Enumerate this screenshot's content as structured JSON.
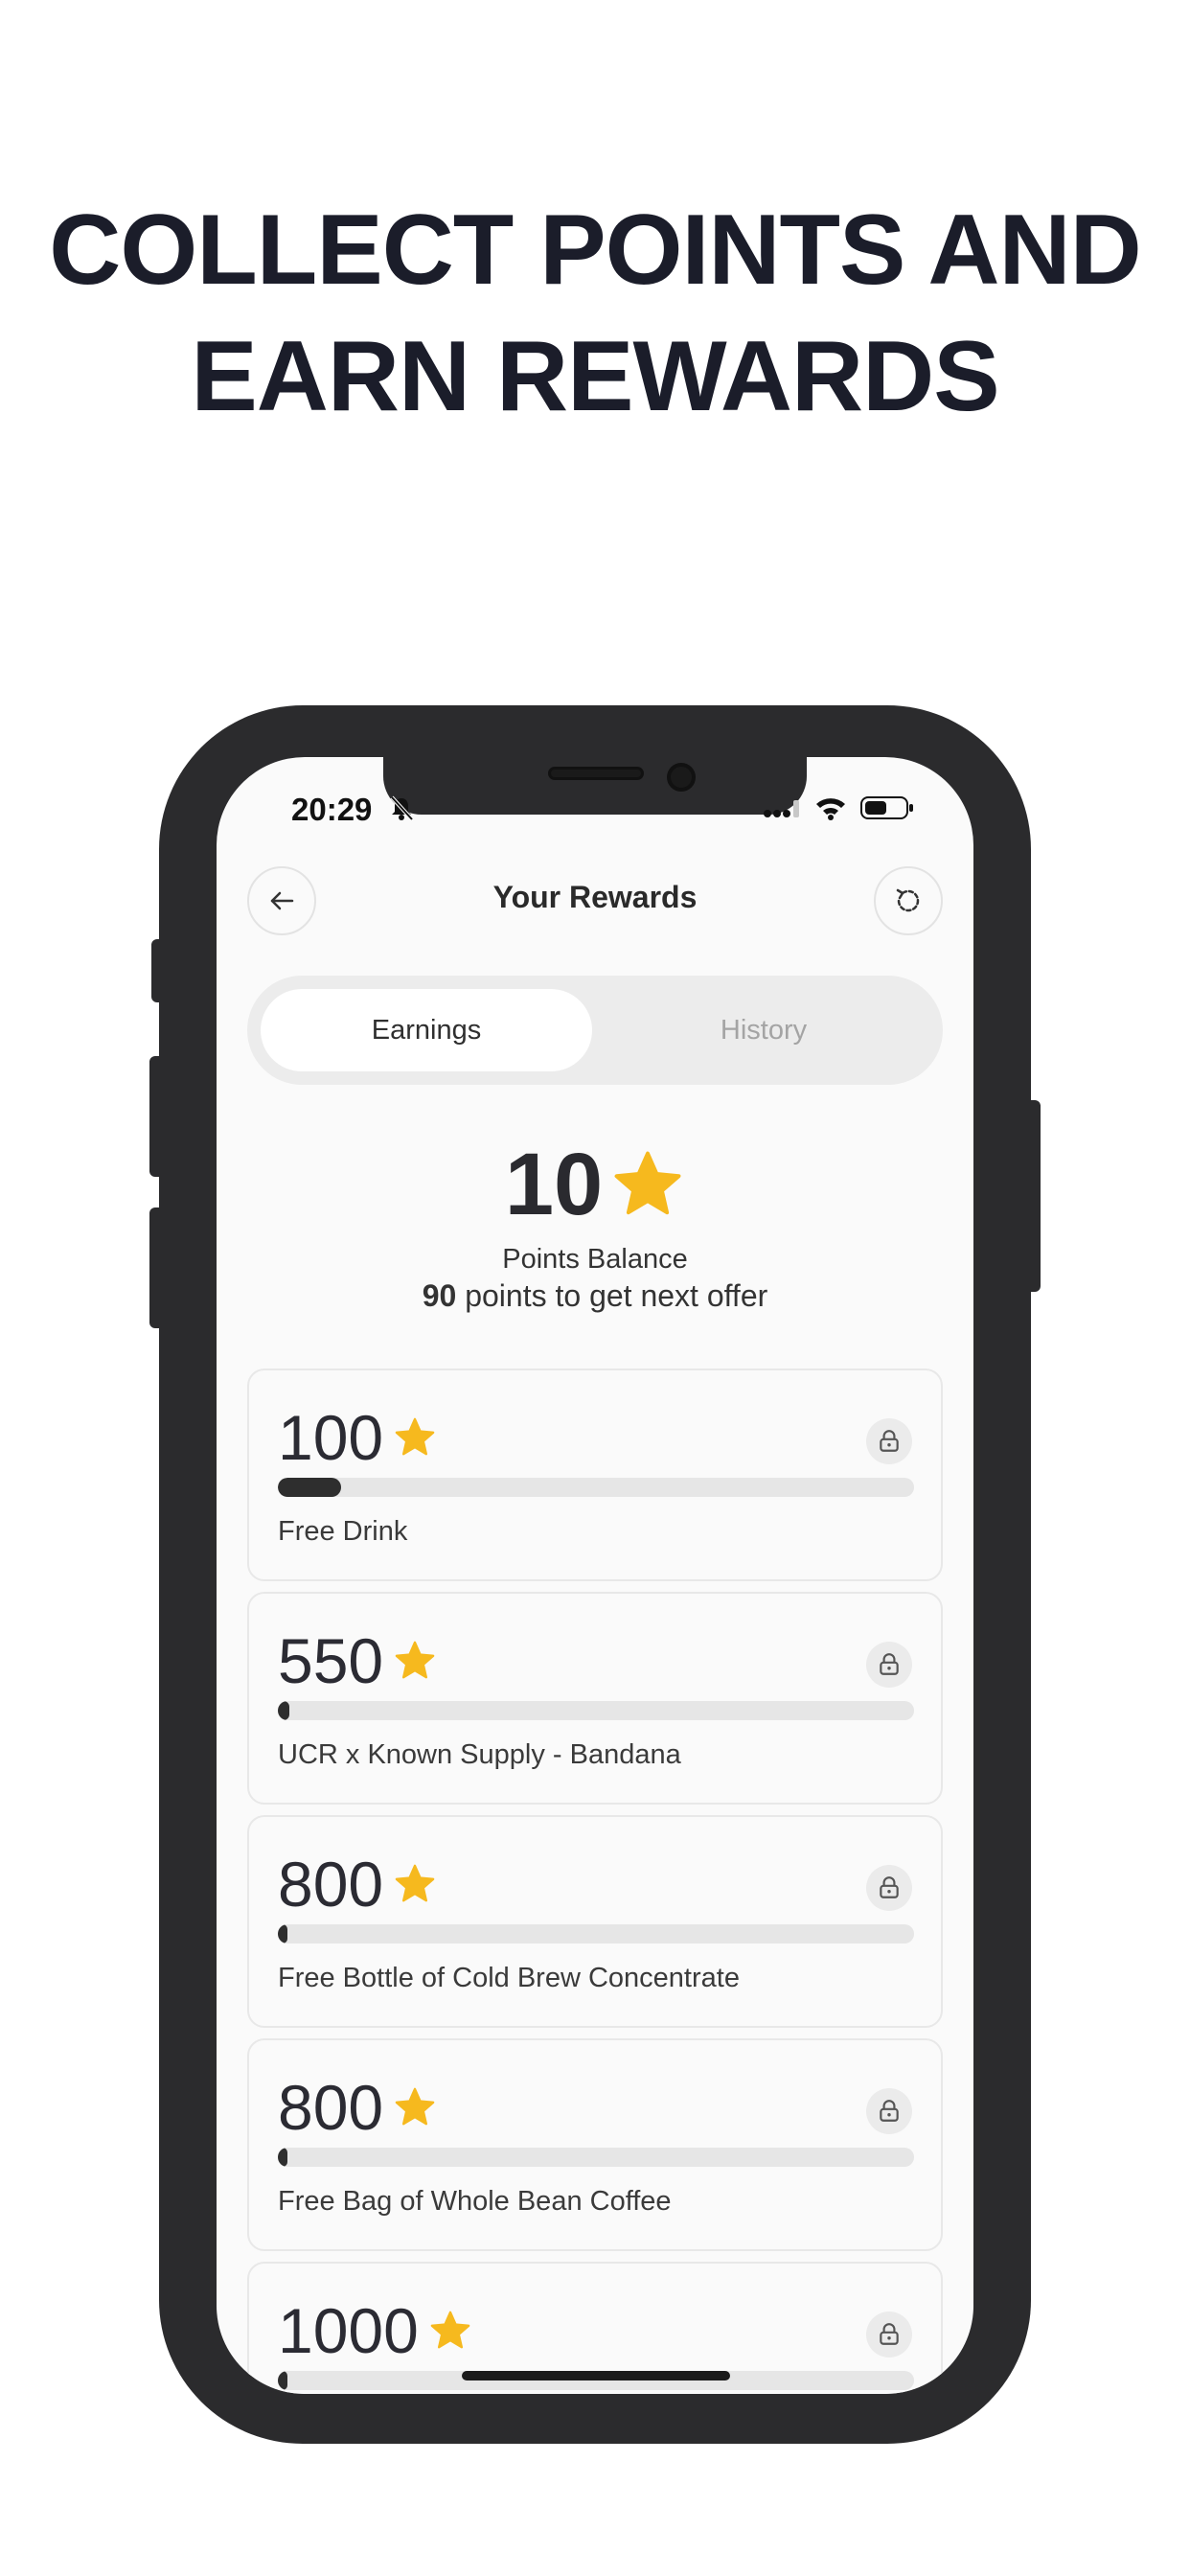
{
  "headline": {
    "line1": "COLLECT POINTS AND",
    "line2": "EARN REWARDS"
  },
  "status_bar": {
    "time": "20:29",
    "icons": [
      "bell-slash-icon",
      "cellular-icon",
      "wifi-icon",
      "battery-icon"
    ]
  },
  "header": {
    "title": "Your Rewards",
    "back_icon": "arrow-left-icon",
    "refresh_icon": "refresh-icon"
  },
  "tabs": [
    {
      "label": "Earnings",
      "selected": true
    },
    {
      "label": "History",
      "selected": false
    }
  ],
  "balance": {
    "points": "10",
    "label": "Points Balance",
    "next_points": "90",
    "next_suffix": " points to get next offer"
  },
  "colors": {
    "star": "#f6b91e",
    "progress_fill": "#2e2e2e",
    "progress_track": "#e6e6e6"
  },
  "rewards": [
    {
      "points": "100",
      "name": "Free Drink",
      "progress": 0.1,
      "locked": true
    },
    {
      "points": "550",
      "name": "UCR x Known Supply - Bandana",
      "progress": 0.018,
      "locked": true
    },
    {
      "points": "800",
      "name": "Free Bottle of Cold Brew Concentrate",
      "progress": 0.0125,
      "locked": true
    },
    {
      "points": "800",
      "name": "Free Bag of Whole Bean Coffee",
      "progress": 0.0125,
      "locked": true
    },
    {
      "points": "1000",
      "name": "",
      "progress": 0.01,
      "locked": true
    }
  ]
}
